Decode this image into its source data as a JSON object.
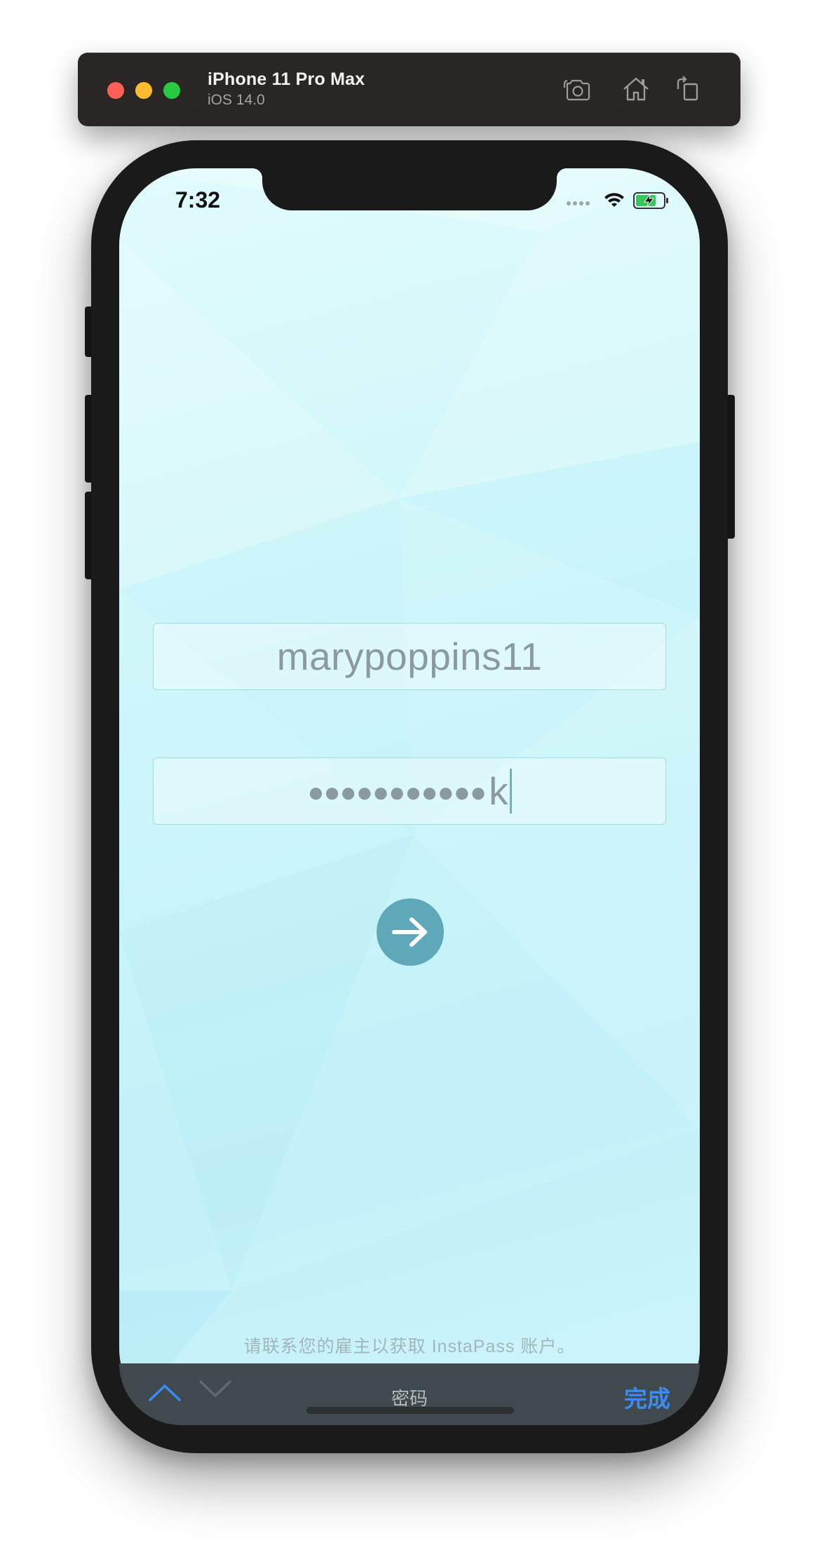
{
  "simulator": {
    "device_name": "iPhone 11 Pro Max",
    "os_version": "iOS 14.0",
    "toolbar_icons": [
      "screenshot-icon",
      "home-icon",
      "rotate-icon"
    ]
  },
  "status_bar": {
    "time": "7:32",
    "icons": [
      "cellular-icon",
      "wifi-icon",
      "battery-charging-icon"
    ]
  },
  "login": {
    "username_value": "marypoppins11",
    "password_masked": "●●●●●●●●●●●",
    "password_last_char": "k"
  },
  "go_button": {
    "icon": "arrow-right-icon",
    "color": "#5ea8ba"
  },
  "footer_note": "请联系您的雇主以获取 InstaPass 账户。",
  "keyboard_toolbar": {
    "field_title": "密码",
    "done_label": "完成",
    "prev_icon": "chevron-up-icon",
    "next_icon": "chevron-down-icon",
    "accent_color": "#3a8cf2"
  }
}
